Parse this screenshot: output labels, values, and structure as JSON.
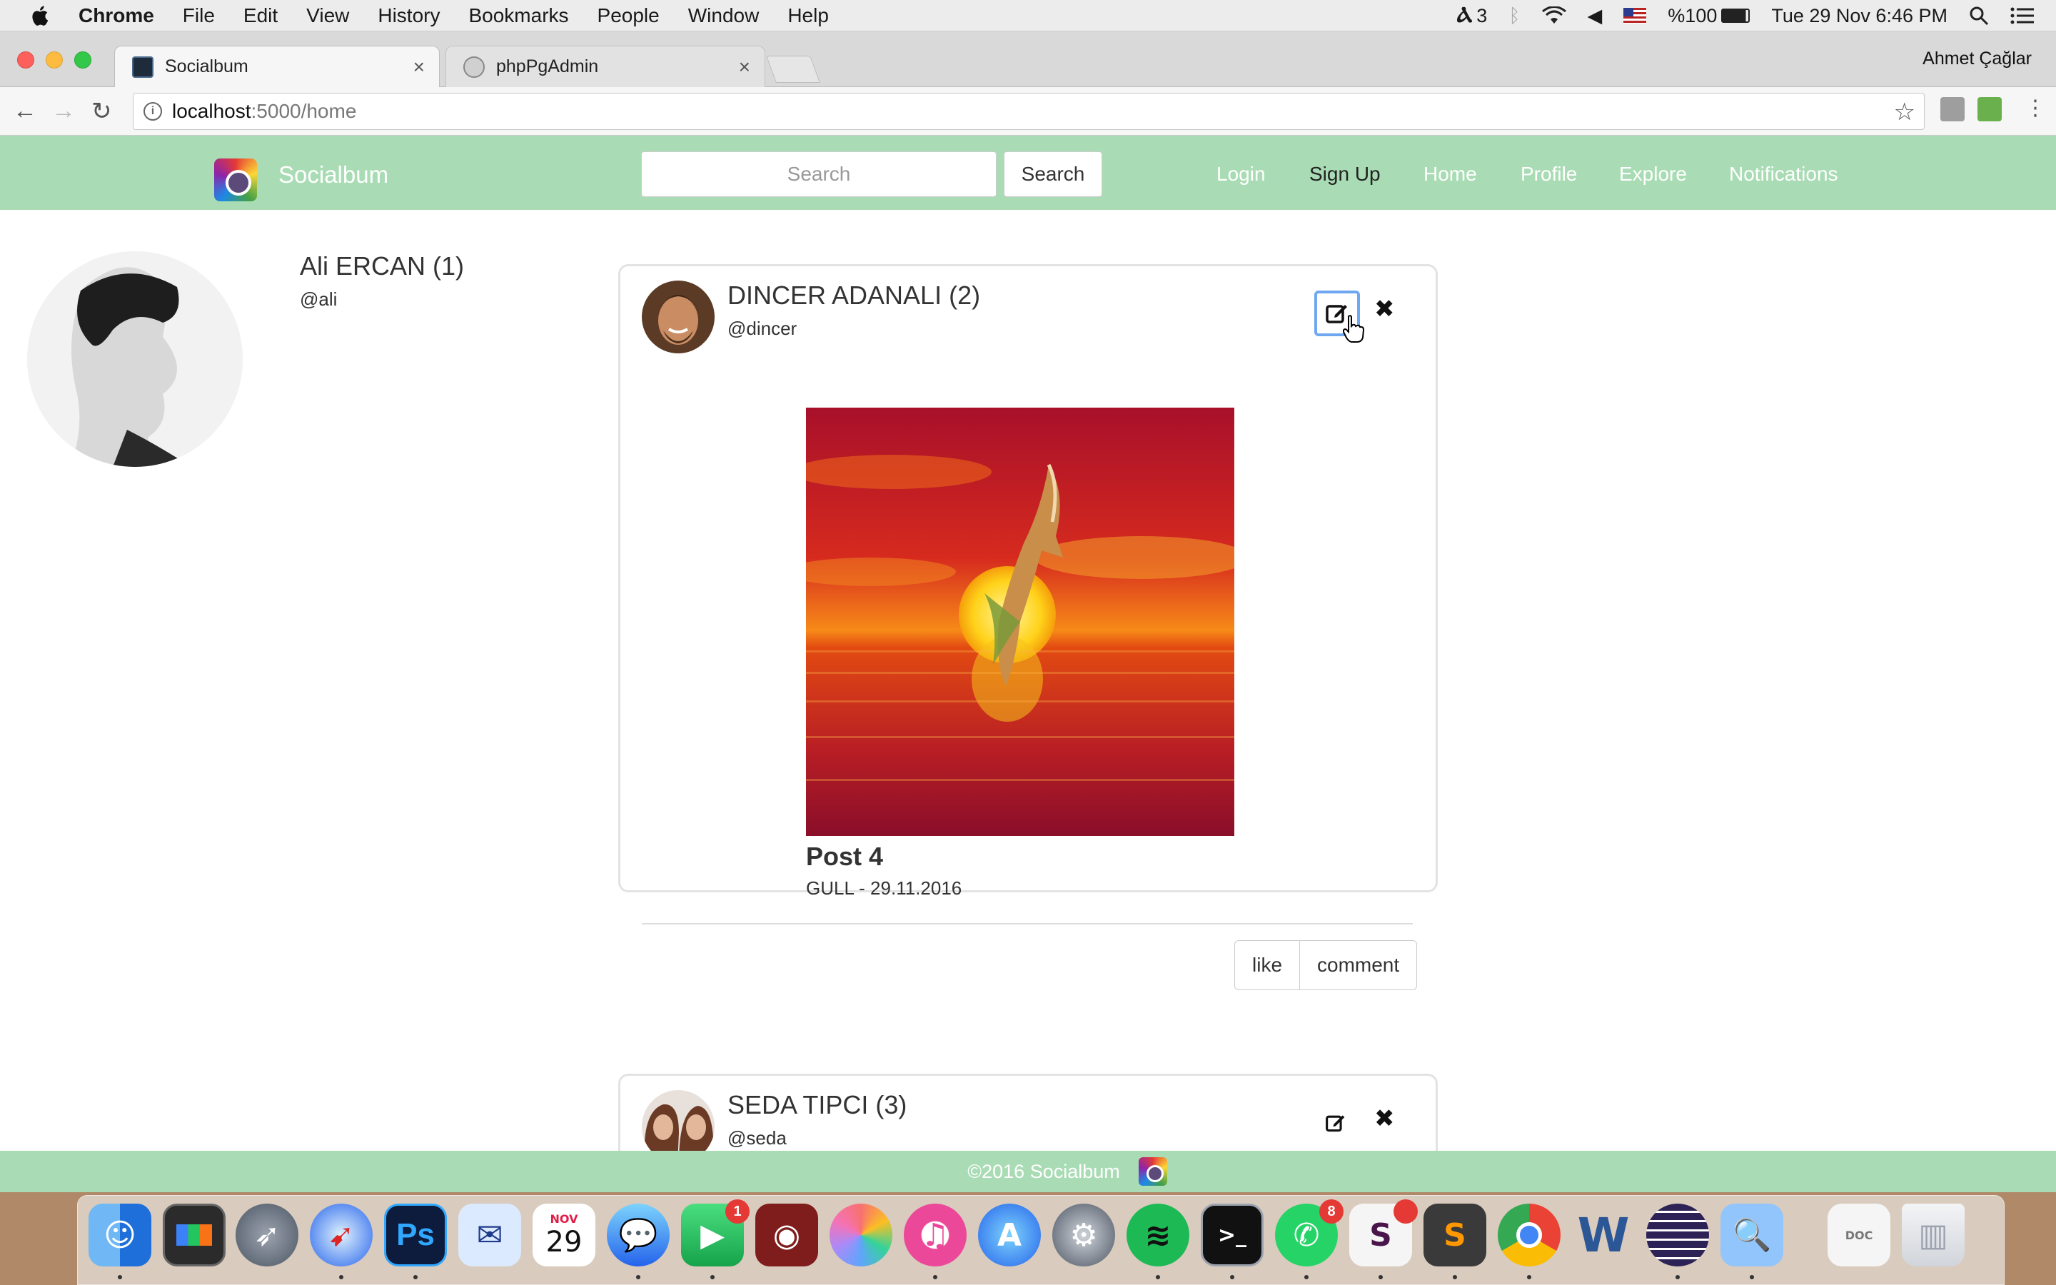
{
  "menubar": {
    "app": "Chrome",
    "items": [
      "File",
      "Edit",
      "View",
      "History",
      "Bookmarks",
      "People",
      "Window",
      "Help"
    ],
    "adobe_count": "3",
    "battery": "%100",
    "datetime": "Tue 29 Nov  6:46 PM"
  },
  "browser": {
    "tabs": [
      {
        "title": "Socialbum",
        "active": true
      },
      {
        "title": "phpPgAdmin",
        "active": false
      }
    ],
    "profile_name": "Ahmet Çağlar",
    "url_host": "localhost",
    "url_path": ":5000/home"
  },
  "navbar": {
    "brand": "Socialbum",
    "search_placeholder": "Search",
    "search_button": "Search",
    "links": [
      "Login",
      "Sign Up",
      "Home",
      "Profile",
      "Explore",
      "Notifications"
    ]
  },
  "current_user": {
    "name": "Ali ERCAN (1)",
    "handle": "@ali"
  },
  "posts": [
    {
      "author": "DINCER ADANALI (2)",
      "handle": "@dincer",
      "title": "Post 4",
      "meta": "GULL - 29.11.2016",
      "like_label": "like",
      "comment_label": "comment"
    },
    {
      "author": "SEDA TIPCI (3)",
      "handle": "@seda"
    }
  ],
  "footer": {
    "copyright": "©2016 Socialbum"
  },
  "dock": {
    "calendar_month": "NOV",
    "calendar_day": "29",
    "facetime_badge": "1",
    "whatsapp_badge": "8"
  },
  "colors": {
    "navbar_bg": "#a9dcb4",
    "focus_ring": "#6fa8f0"
  }
}
